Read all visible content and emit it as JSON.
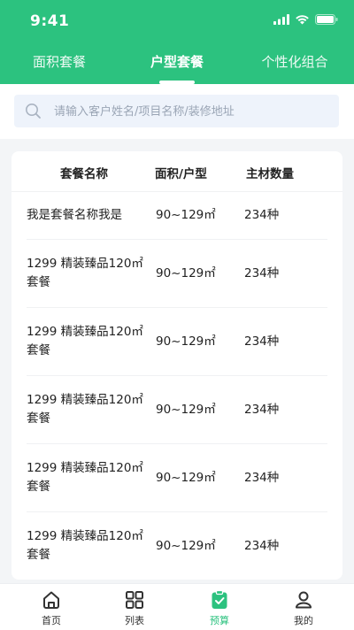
{
  "status_bar": {
    "time": "9:41"
  },
  "tabs": [
    {
      "label": "面积套餐"
    },
    {
      "label": "户型套餐"
    },
    {
      "label": "个性化组合"
    }
  ],
  "search": {
    "placeholder": "请输入客户姓名/项目名称/装修地址",
    "value": ""
  },
  "table": {
    "headers": {
      "name": "套餐名称",
      "area": "面积/户型",
      "count": "主材数量"
    },
    "rows": [
      {
        "name": "我是套餐名称我是",
        "area": "90~129㎡",
        "count": "234种"
      },
      {
        "name": "1299 精装臻品120㎡套餐",
        "area": "90~129㎡",
        "count": "234种"
      },
      {
        "name": "1299 精装臻品120㎡套餐",
        "area": "90~129㎡",
        "count": "234种"
      },
      {
        "name": "1299 精装臻品120㎡套餐",
        "area": "90~129㎡",
        "count": "234种"
      },
      {
        "name": "1299 精装臻品120㎡套餐",
        "area": "90~129㎡",
        "count": "234种"
      },
      {
        "name": "1299 精装臻品120㎡套餐",
        "area": "90~129㎡",
        "count": "234种"
      }
    ]
  },
  "tabbar": [
    {
      "label": "首页",
      "icon": "home-icon"
    },
    {
      "label": "列表",
      "icon": "grid-icon"
    },
    {
      "label": "预算",
      "icon": "clipboard-check-icon"
    },
    {
      "label": "我的",
      "icon": "user-icon"
    }
  ],
  "colors": {
    "brand": "#2cc27f",
    "search_bg": "#eef3fb",
    "page_bg": "#f3f5f7"
  }
}
